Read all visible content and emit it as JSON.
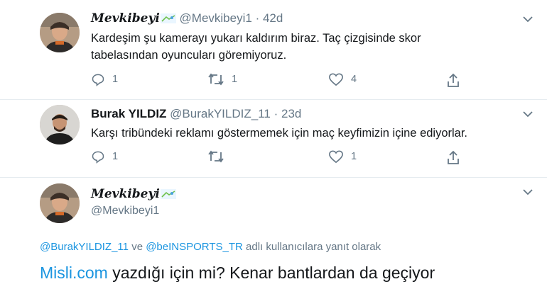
{
  "tweets": [
    {
      "display_name": "Mevkibeyi",
      "handle": "@Mevkibeyi1",
      "time": "42d",
      "text_line1": "Kardeşim şu kamerayı yukarı kaldırım biraz. Taç çizgisinde skor",
      "text_line2": "tabelasından oyuncuları göremiyoruz.",
      "reply_count": "1",
      "retweet_count": "1",
      "like_count": "4"
    },
    {
      "display_name": "Burak YILDIZ",
      "handle": "@BurakYILDIZ_11",
      "time": "23d",
      "text_line1": "Karşı tribündeki reklamı göstermemek için maç keyfimizin içine ediyorlar.",
      "reply_count": "1",
      "retweet_count": "",
      "like_count": "1"
    }
  ],
  "focused": {
    "display_name": "Mevkibeyi",
    "handle": "@Mevkibeyi1",
    "reply_to_1": "@BurakYILDIZ_11",
    "reply_conj": "ve",
    "reply_to_2": "@beINSPORTS_TR",
    "reply_suffix": "adlı kullanıcılara yanıt olarak",
    "link": "Misli.com",
    "text": "yazdığı için mi? Kenar bantlardan da geçiyor"
  },
  "colors": {
    "accent": "#1b95e0",
    "muted": "#657786",
    "text": "#14171a"
  }
}
